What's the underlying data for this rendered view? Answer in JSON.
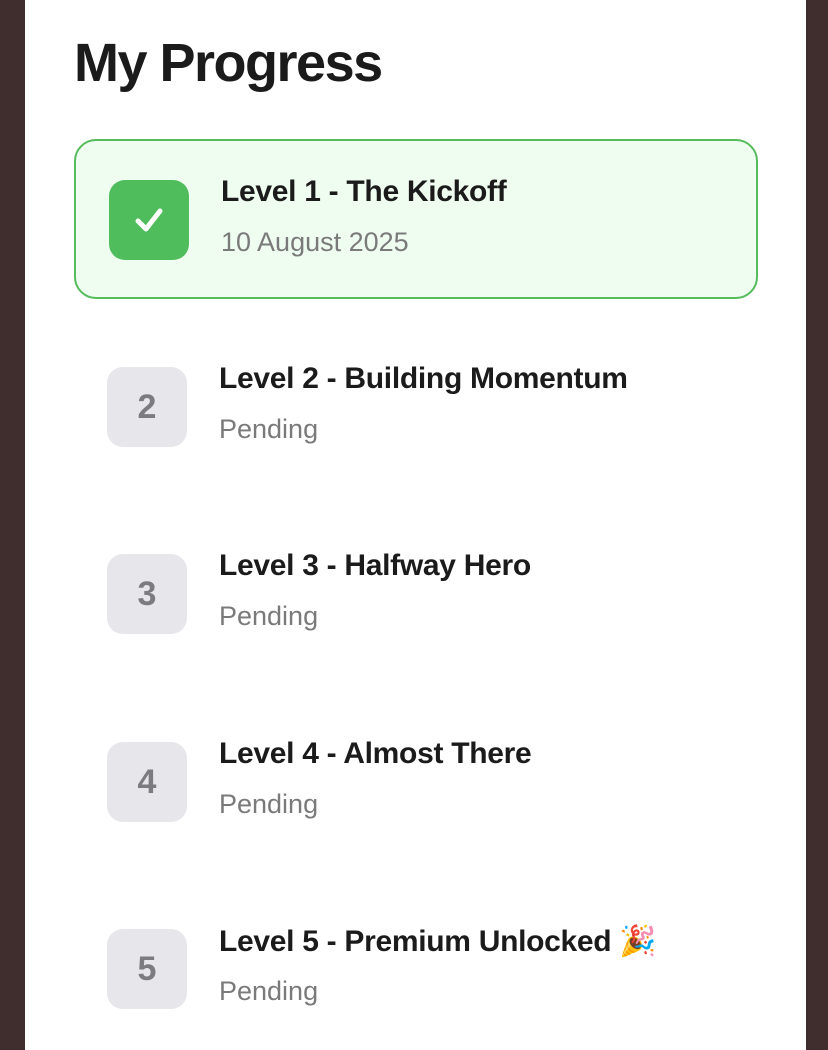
{
  "page": {
    "title": "My Progress"
  },
  "levels": [
    {
      "badge": "✓",
      "title": "Level 1 - The Kickoff",
      "subtitle": "10 August 2025",
      "status": "completed"
    },
    {
      "badge": "2",
      "title": "Level 2 - Building Momentum",
      "subtitle": "Pending",
      "status": "pending"
    },
    {
      "badge": "3",
      "title": "Level 3 - Halfway Hero",
      "subtitle": "Pending",
      "status": "pending"
    },
    {
      "badge": "4",
      "title": "Level 4 - Almost There",
      "subtitle": "Pending",
      "status": "pending"
    },
    {
      "badge": "5",
      "title": "Level 5 - Premium Unlocked 🎉",
      "subtitle": "Pending",
      "status": "pending"
    }
  ],
  "colors": {
    "background": "#3f2e2d",
    "panel": "#ffffff",
    "completed_fill": "#effdf1",
    "completed_border": "#56bb5d",
    "completed_badge": "#50bd5c",
    "pending_badge": "#e6e6eb",
    "pending_text": "#7a7a7a"
  }
}
